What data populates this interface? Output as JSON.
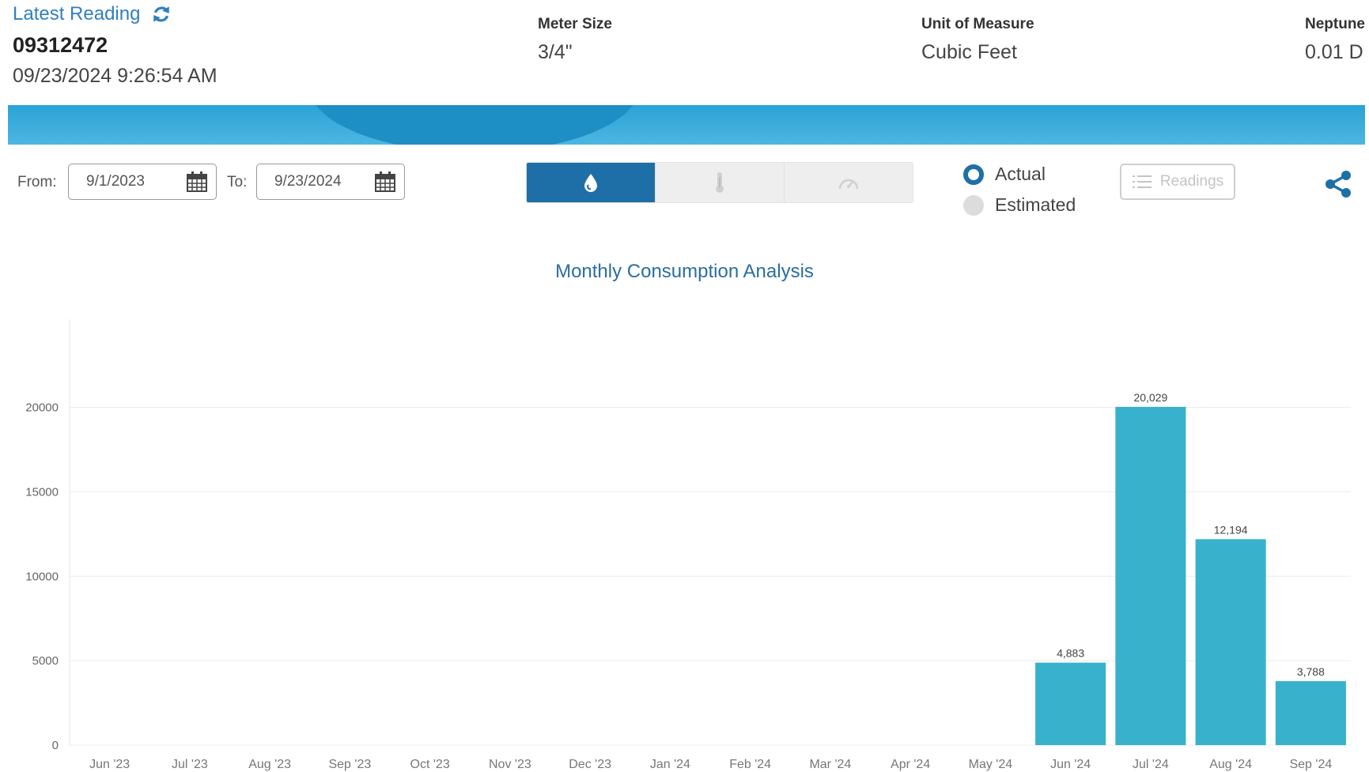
{
  "header": {
    "latest_title": "Latest Reading",
    "meter_id": "09312472",
    "timestamp": "09/23/2024 9:26:54 AM",
    "meter_size_label": "Meter Size",
    "meter_size_value": "3/4\"",
    "unit_label": "Unit of Measure",
    "unit_value": "Cubic Feet",
    "neptune_label": "Neptune",
    "neptune_value": "0.01 D"
  },
  "filters": {
    "from_label": "From:",
    "from_value": "9/1/2023",
    "to_label": "To:",
    "to_value": "9/23/2024"
  },
  "toggle": {
    "items": [
      "water-drop-icon",
      "thermometer-icon",
      "gauge-icon"
    ],
    "active": 0
  },
  "radios": {
    "actual_label": "Actual",
    "estimated_label": "Estimated",
    "selected": "Actual"
  },
  "readings_button": "Readings",
  "colors": {
    "accent": "#1e6fa8",
    "bar": "#38b2cc",
    "banner": "#2aa3d6",
    "title_link": "#2f7fc1"
  },
  "chart_data": {
    "type": "bar",
    "title": "Monthly Consumption Analysis",
    "categories": [
      "Jun '23",
      "Jul '23",
      "Aug '23",
      "Sep '23",
      "Oct '23",
      "Nov '23",
      "Dec '23",
      "Jan '24",
      "Feb '24",
      "Mar '24",
      "Apr '24",
      "May '24",
      "Jun '24",
      "Jul '24",
      "Aug '24",
      "Sep '24"
    ],
    "values": [
      0,
      0,
      0,
      0,
      0,
      0,
      0,
      0,
      0,
      0,
      0,
      0,
      4883,
      20029,
      12194,
      3788
    ],
    "data_labels": [
      "",
      "",
      "",
      "",
      "",
      "",
      "",
      "",
      "",
      "",
      "",
      "",
      "4,883",
      "20,029",
      "12,194",
      "3,788"
    ],
    "yticks": [
      0,
      5000,
      10000,
      15000,
      20000
    ],
    "ylim": [
      0,
      24000
    ],
    "grid": true,
    "xlabel": "",
    "ylabel": ""
  }
}
